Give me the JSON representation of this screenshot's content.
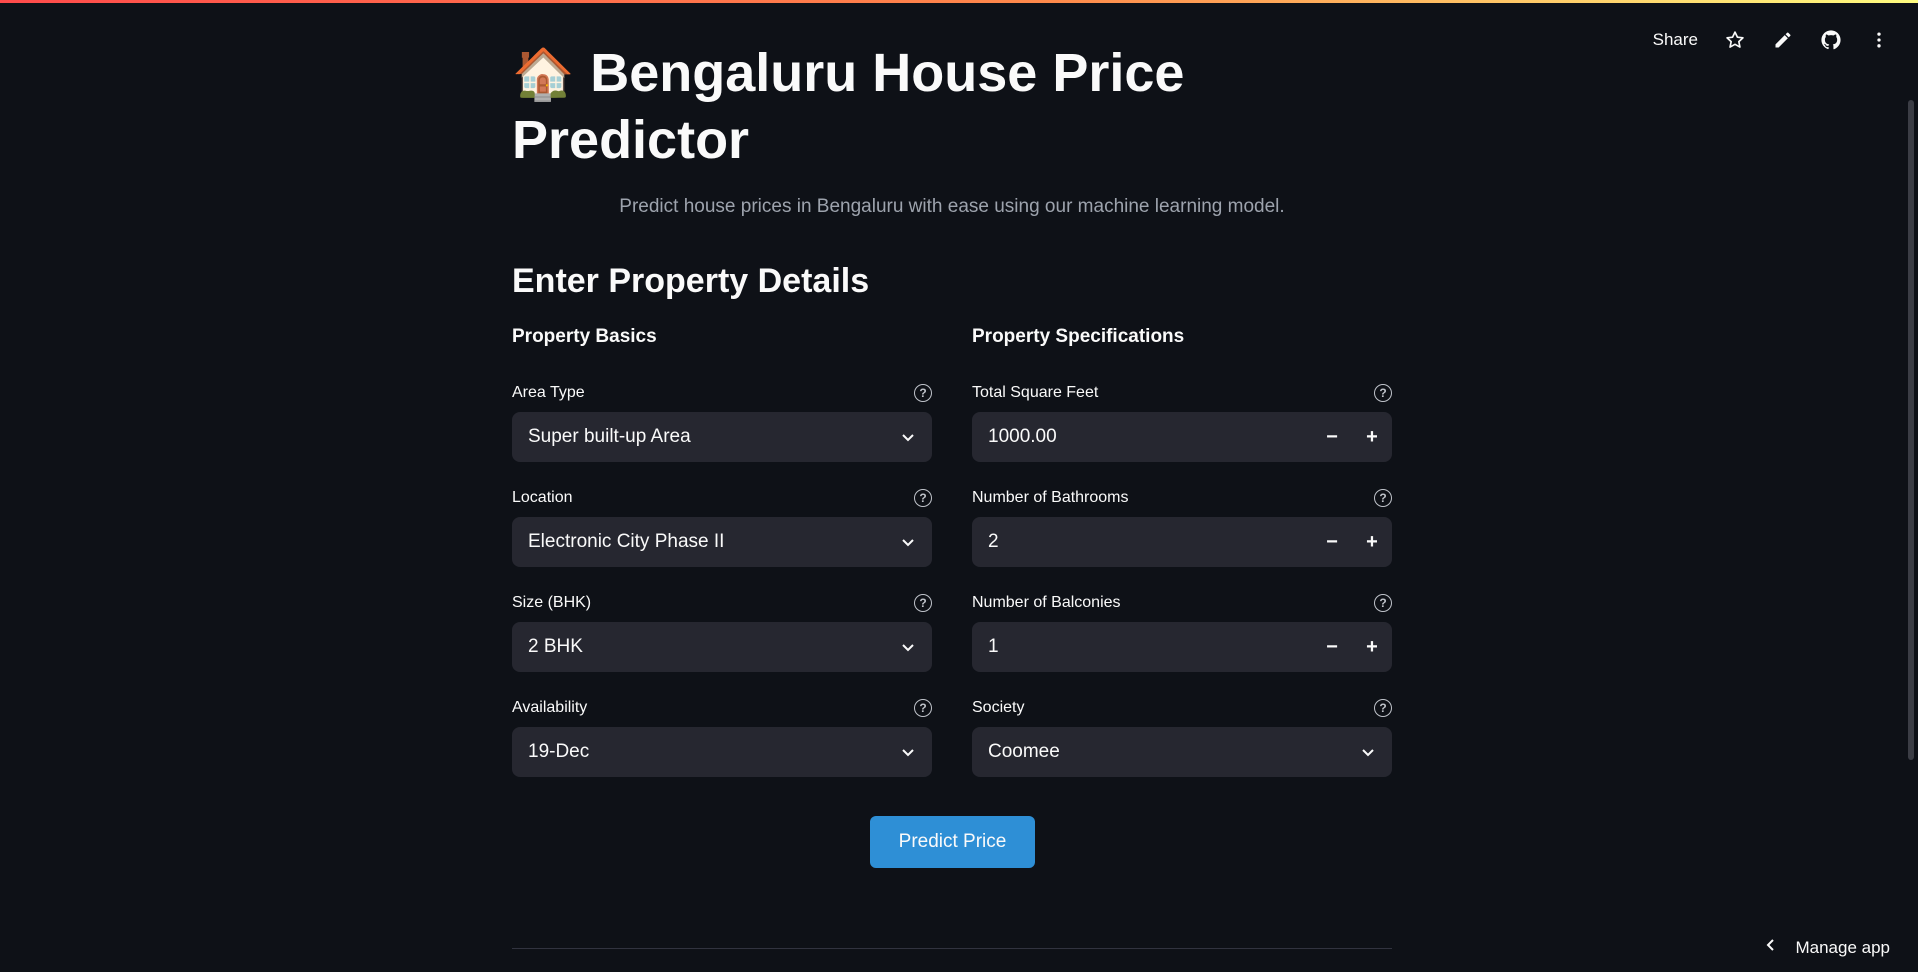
{
  "toolbar": {
    "share_label": "Share",
    "icons": [
      "star-icon",
      "pencil-icon",
      "github-icon",
      "more-vertical-icon"
    ]
  },
  "header": {
    "emoji": "🏠",
    "title": "Bengaluru House Price Predictor",
    "subtitle": "Predict house prices in Bengaluru with ease using our machine learning model."
  },
  "form": {
    "section_title": "Enter Property Details",
    "left": {
      "header": "Property Basics",
      "fields": [
        {
          "label": "Area Type",
          "value": "Super built-up Area"
        },
        {
          "label": "Location",
          "value": "Electronic City Phase II"
        },
        {
          "label": "Size (BHK)",
          "value": "2 BHK"
        },
        {
          "label": "Availability",
          "value": "19-Dec"
        }
      ]
    },
    "right": {
      "header": "Property Specifications",
      "fields": [
        {
          "label": "Total Square Feet",
          "value": "1000.00"
        },
        {
          "label": "Number of Bathrooms",
          "value": "2"
        },
        {
          "label": "Number of Balconies",
          "value": "1"
        },
        {
          "label": "Society",
          "value": "Coomee"
        }
      ]
    },
    "stepper_minus": "−",
    "stepper_plus": "+",
    "help_glyph": "?",
    "predict_label": "Predict Price"
  },
  "footer": {
    "manage_app_label": "Manage app"
  },
  "colors": {
    "background": "#0e1117",
    "input_bg": "#262730",
    "primary_button": "#2e8fd6",
    "text": "#fafafa",
    "muted_text": "#9da3ad"
  }
}
